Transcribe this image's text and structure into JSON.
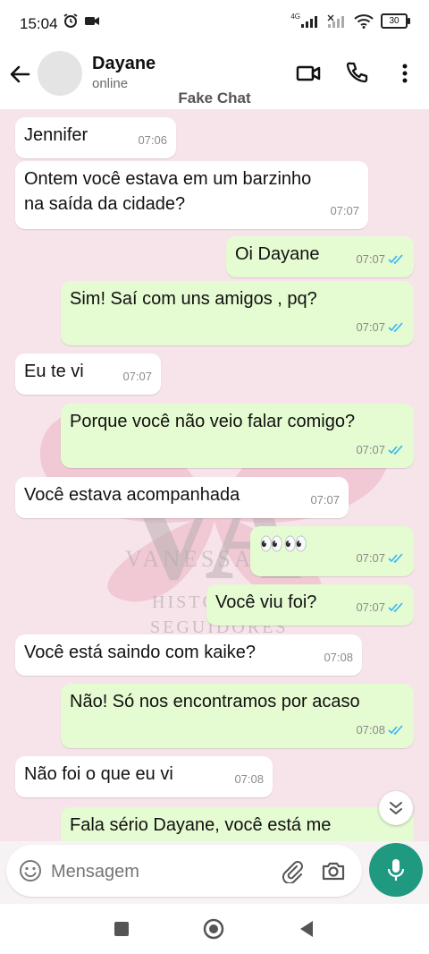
{
  "status": {
    "time": "15:04",
    "network": "4G",
    "battery": "30"
  },
  "header": {
    "name": "Dayane",
    "status": "online",
    "subtitle": "Fake Chat"
  },
  "watermark": {
    "letters": "VA",
    "line1": "VANESSA",
    "line2": "HISTÓRIAS",
    "line3": "SEGUIDORES"
  },
  "messages": [
    {
      "dir": "in",
      "text": "Jennifer",
      "time": "07:06"
    },
    {
      "dir": "in",
      "text": "Ontem você estava em um barzinho\nna saída da cidade?",
      "time": "07:07"
    },
    {
      "dir": "out",
      "text": "Oi Dayane",
      "time": "07:07"
    },
    {
      "dir": "out",
      "text": "Sim! Saí com uns amigos , pq?",
      "time": "07:07"
    },
    {
      "dir": "in",
      "text": "Eu te vi",
      "time": "07:07"
    },
    {
      "dir": "out",
      "text": "Porque você não veio falar comigo?",
      "time": "07:07"
    },
    {
      "dir": "in",
      "text": "Você estava acompanhada",
      "time": "07:07"
    },
    {
      "dir": "out",
      "text": "👀👀",
      "time": "07:07"
    },
    {
      "dir": "out",
      "text": "Você viu foi?",
      "time": "07:07"
    },
    {
      "dir": "in",
      "text": "Você está saindo com kaike?",
      "time": "07:08"
    },
    {
      "dir": "out",
      "text": "Não! Só nos encontramos por acaso",
      "time": "07:08"
    },
    {
      "dir": "in",
      "text": "Não foi o que eu vi",
      "time": "07:08"
    },
    {
      "dir": "out",
      "text": "Fala sério Dayane, você está me",
      "time": ""
    }
  ],
  "composer": {
    "placeholder": "Mensagem"
  },
  "colors": {
    "incoming": "#ffffff",
    "outgoing": "#e5fbd1",
    "chat_bg": "#f7e4ea",
    "read_ticks": "#34b7f1",
    "mic_button": "#1f9a80"
  }
}
